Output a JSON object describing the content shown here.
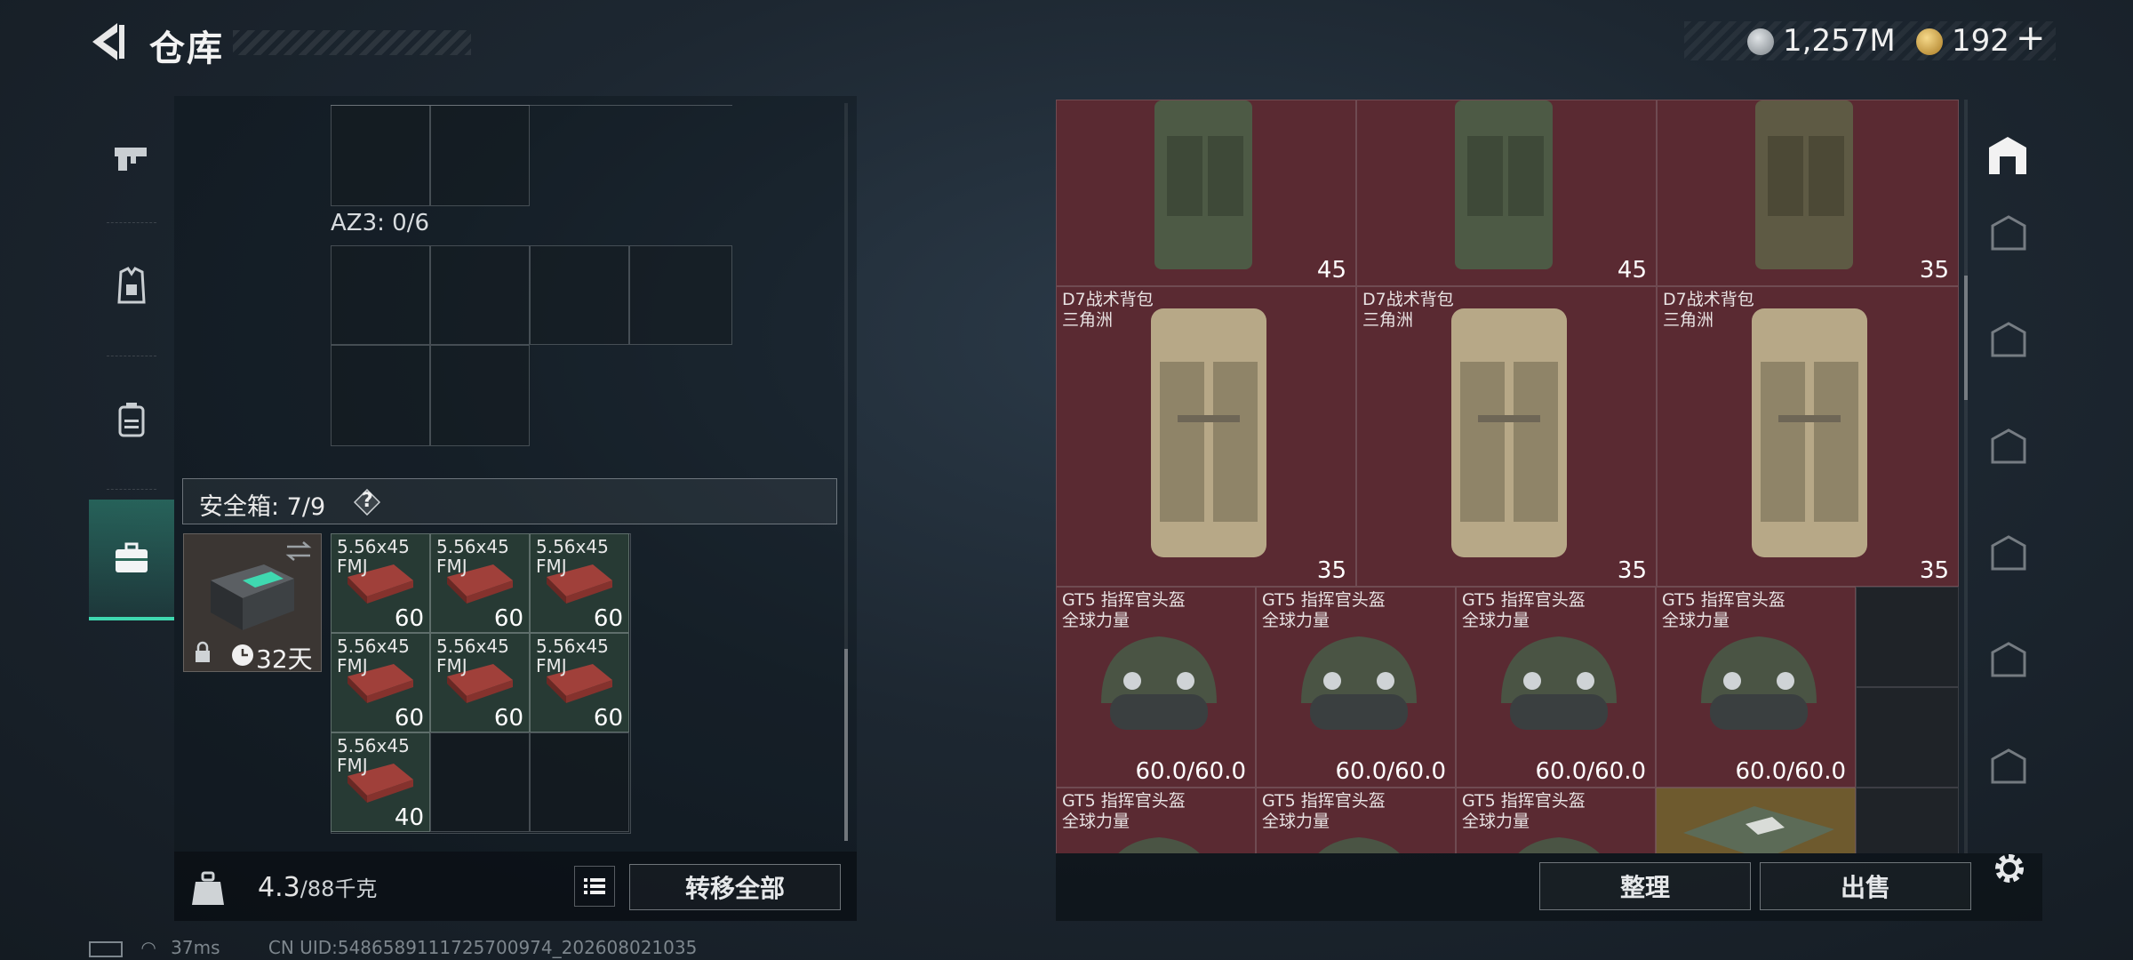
{
  "header": {
    "title": "仓库"
  },
  "currency": [
    {
      "icon": "silver-coin-icon",
      "value": "1,257M"
    },
    {
      "icon": "gold-coin-icon",
      "value": "192"
    }
  ],
  "containers": {
    "az3_label": "AZ3: 0/6"
  },
  "safebox": {
    "label": "安全箱: 7/9",
    "help": "?",
    "days": "32天"
  },
  "ammo": [
    {
      "name": "5.56x45 FMJ",
      "qty": "60"
    },
    {
      "name": "5.56x45 FMJ",
      "qty": "60"
    },
    {
      "name": "5.56x45 FMJ",
      "qty": "60"
    },
    {
      "name": "5.56x45 FMJ",
      "qty": "60"
    },
    {
      "name": "5.56x45 FMJ",
      "qty": "60"
    },
    {
      "name": "5.56x45 FMJ",
      "qty": "60"
    },
    {
      "name": "5.56x45 FMJ",
      "qty": "40"
    }
  ],
  "footer_left": {
    "weight": "4.3",
    "capacity": "/88千克",
    "transfer_all": "转移全部"
  },
  "stash": {
    "top_row": [
      "45",
      "45",
      "35"
    ],
    "backpacks": [
      {
        "name": "D7战术背包",
        "sub": "三角洲",
        "capacity": "35"
      },
      {
        "name": "D7战术背包",
        "sub": "三角洲",
        "capacity": "35"
      },
      {
        "name": "D7战术背包",
        "sub": "三角洲",
        "capacity": "35"
      }
    ],
    "helmets": [
      {
        "name": "GT5 指挥官头盔",
        "sub": "全球力量",
        "durability": "60.0/60.0"
      },
      {
        "name": "GT5 指挥官头盔",
        "sub": "全球力量",
        "durability": "60.0/60.0"
      },
      {
        "name": "GT5 指挥官头盔",
        "sub": "全球力量",
        "durability": "60.0/60.0"
      },
      {
        "name": "GT5 指挥官头盔",
        "sub": "全球力量",
        "durability": "60.0/60.0"
      }
    ],
    "helmets_row2": [
      {
        "name": "GT5 指挥官头盔",
        "sub": "全球力量"
      },
      {
        "name": "GT5 指挥官头盔",
        "sub": "全球力量"
      },
      {
        "name": "GT5 指挥官头盔",
        "sub": "全球力量"
      }
    ]
  },
  "footer_right": {
    "sort": "整理",
    "sell": "出售"
  },
  "status": {
    "ping": "37ms",
    "uid": "CN UID:5486589111725700974_202608021035"
  },
  "colors": {
    "stash_bg": "#5a2a32",
    "ammo_bg": "#273a34",
    "accent": "#3fd8b0"
  }
}
